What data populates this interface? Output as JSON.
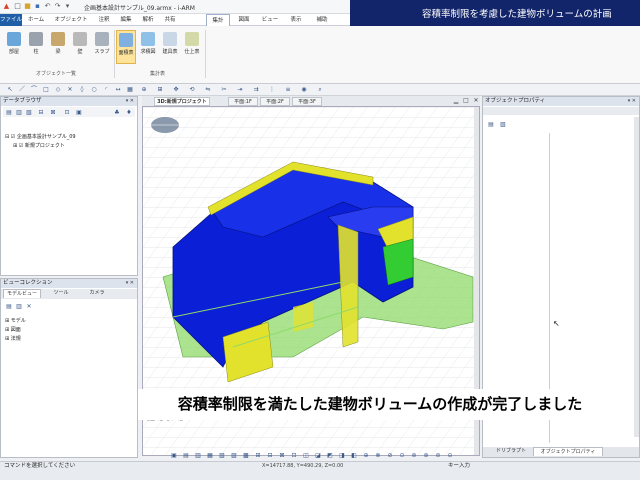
{
  "window": {
    "title": "企画基本設計サンプル_09.armx - i-ARM"
  },
  "banner": {
    "text": "容積率制限を考慮した建物ボリュームの計画"
  },
  "ribbon_tabs": [
    {
      "label": "ファイル"
    },
    {
      "label": "ホーム"
    },
    {
      "label": "オブジェクト"
    },
    {
      "label": "注釈"
    },
    {
      "label": "編集"
    },
    {
      "label": "解析"
    },
    {
      "label": "共有"
    },
    {
      "label": "集計"
    },
    {
      "label": "図面"
    },
    {
      "label": "ビュー"
    },
    {
      "label": "表示"
    },
    {
      "label": "補助"
    }
  ],
  "ribbon": {
    "object_group": {
      "label": "オブジェクト一覧",
      "buttons": [
        {
          "label": "部屋"
        },
        {
          "label": "柱"
        },
        {
          "label": "梁"
        },
        {
          "label": "壁"
        },
        {
          "label": "スラブ"
        }
      ]
    },
    "schedule_group": {
      "label": "集計表",
      "buttons": [
        {
          "label": "面積表"
        },
        {
          "label": "求積図"
        },
        {
          "label": "建具表"
        },
        {
          "label": "仕上表"
        }
      ]
    }
  },
  "data_browser": {
    "title": "データブラウザ",
    "tree": [
      {
        "label": "企画基本設計サンプル_09"
      },
      {
        "label": "新規プロジェクト"
      }
    ]
  },
  "view_collection": {
    "title": "ビューコレクション",
    "tabs": [
      {
        "label": "モデルビュー"
      },
      {
        "label": "ツール"
      },
      {
        "label": "カメラ"
      }
    ],
    "tree": [
      {
        "label": "モデル"
      },
      {
        "label": "図面"
      },
      {
        "label": "法規"
      }
    ]
  },
  "view_tabs": [
    {
      "label": "3D:新規プロジェクト"
    },
    {
      "label": "平面:1F"
    },
    {
      "label": "平面:2F"
    },
    {
      "label": "平面:3F"
    }
  ],
  "viewport": {
    "floor_label": "地上1階 地下0階"
  },
  "properties": {
    "title": "オブジェクトプロパティ",
    "bottom_tabs": [
      {
        "label": "ドリブラプト"
      },
      {
        "label": "オブジェクトプロパティ"
      }
    ]
  },
  "status": {
    "prompt": "コマンドを選択してください",
    "coords": "X=14717.88, Y=490.29, Z=0.00",
    "key_input": "キー入力"
  },
  "subtitle": {
    "text": "容積率制限を満たした建物ボリュームの作成が完了しました"
  },
  "colors": {
    "banner_bg": "#12246a",
    "volume_blue": "#0a1fd6",
    "volume_yellow": "#e2e22c",
    "site_green": "#8fd96a"
  }
}
